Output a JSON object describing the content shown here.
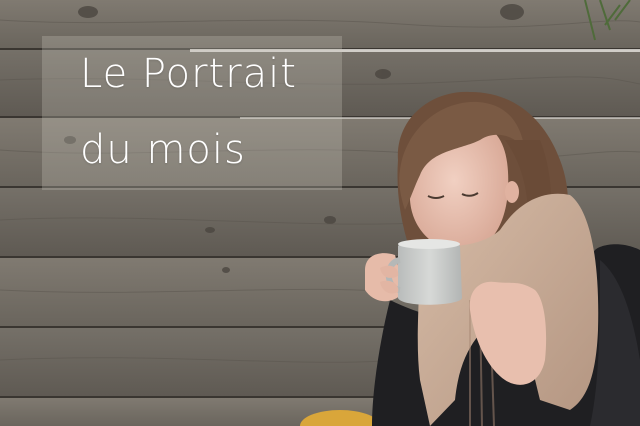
{
  "caption": {
    "line1": "Le Portrait",
    "line2": "du mois"
  },
  "colors": {
    "wood_dark": "#4f4a43",
    "wood_light": "#8d877e",
    "scarf": "#c9ad98",
    "jacket": "#1f1f22",
    "mug": "#c9cbc9",
    "hair": "#7a5a44",
    "skin": "#e9c3b3"
  }
}
